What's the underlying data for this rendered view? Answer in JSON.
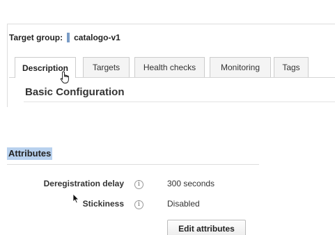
{
  "target_group": {
    "label": "Target group:",
    "name": "catalogo-v1"
  },
  "tabs": [
    {
      "label": "Description",
      "active": true
    },
    {
      "label": "Targets",
      "active": false
    },
    {
      "label": "Health checks",
      "active": false
    },
    {
      "label": "Monitoring",
      "active": false
    },
    {
      "label": "Tags",
      "active": false
    }
  ],
  "basic_configuration": {
    "title": "Basic Configuration"
  },
  "attributes": {
    "title": "Attributes",
    "rows": [
      {
        "label": "Deregistration delay",
        "value": "300 seconds",
        "info_icon": "info-icon"
      },
      {
        "label": "Stickiness",
        "value": "Disabled",
        "info_icon": "info-icon"
      }
    ],
    "edit_button_label": "Edit attributes"
  },
  "colors": {
    "marker": "#7a9cc6",
    "selection_highlight": "#b8d1ee"
  }
}
